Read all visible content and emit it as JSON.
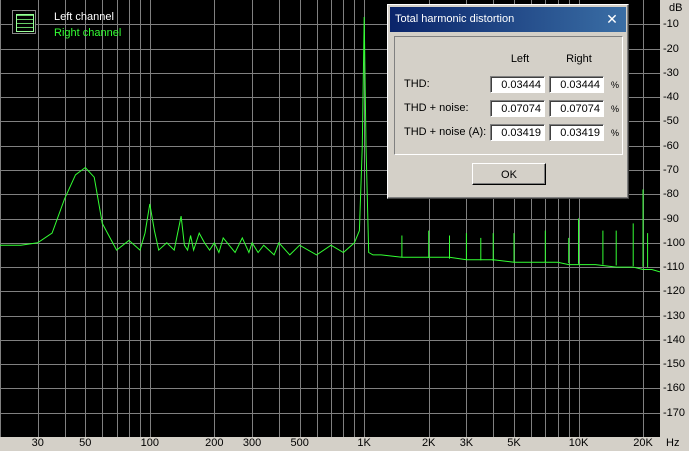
{
  "legend": {
    "left_label": "Left channel",
    "right_label": "Right channel",
    "left_color": "#ffffff",
    "right_color": "#33ff33"
  },
  "axis": {
    "y_unit": "dB",
    "x_unit": "Hz",
    "y_ticks": [
      "-10",
      "-20",
      "-30",
      "-40",
      "-50",
      "-60",
      "-70",
      "-80",
      "-90",
      "-100",
      "-110",
      "-120",
      "-130",
      "-140",
      "-150",
      "-160",
      "-170"
    ],
    "x_ticks": [
      "30",
      "50",
      "100",
      "200",
      "300",
      "500",
      "1K",
      "2K",
      "3K",
      "5K",
      "10K",
      "20K"
    ]
  },
  "dialog": {
    "title": "Total harmonic distortion",
    "close_glyph": "✕",
    "col_left": "Left",
    "col_right": "Right",
    "rows": [
      {
        "label": "THD:",
        "left": "0.03444",
        "right": "0.03444",
        "unit": "%"
      },
      {
        "label": "THD + noise:",
        "left": "0.07074",
        "right": "0.07074",
        "unit": "%"
      },
      {
        "label": "THD + noise (A):",
        "left": "0.03419",
        "right": "0.03419",
        "unit": "%"
      }
    ],
    "ok_label": "OK"
  },
  "colors": {
    "plot_background": "#000000",
    "grid": "#808080",
    "trace": "#33ff33",
    "dialog_title": "#0a246a"
  },
  "chart_data": {
    "type": "line",
    "xscale": "log",
    "xlim": [
      20,
      24000
    ],
    "ylim": [
      -180,
      0
    ],
    "ylabel": "dB",
    "xlabel": "Hz",
    "series": [
      {
        "name": "Right channel",
        "x": [
          20,
          25,
          30,
          35,
          40,
          45,
          50,
          55,
          60,
          70,
          80,
          90,
          95,
          100,
          105,
          110,
          120,
          130,
          140,
          145,
          150,
          155,
          160,
          170,
          180,
          190,
          200,
          210,
          220,
          250,
          270,
          290,
          300,
          320,
          340,
          380,
          400,
          450,
          500,
          600,
          700,
          800,
          900,
          950,
          980,
          1000,
          1020,
          1050,
          1100,
          1200,
          1500,
          2000,
          2500,
          3000,
          3500,
          4000,
          5000,
          6000,
          7000,
          8000,
          9000,
          10000,
          12000,
          15000,
          18000,
          20000,
          22000,
          24000
        ],
        "y": [
          -101,
          -101,
          -100,
          -96,
          -82,
          -72,
          -69,
          -73,
          -92,
          -103,
          -99,
          -103,
          -96,
          -84,
          -95,
          -103,
          -100,
          -103,
          -89,
          -101,
          -103,
          -97,
          -103,
          -96,
          -100,
          -103,
          -100,
          -104,
          -98,
          -104,
          -98,
          -104,
          -100,
          -104,
          -101,
          -105,
          -100,
          -105,
          -101,
          -105,
          -101,
          -104,
          -100,
          -95,
          -60,
          -7,
          -60,
          -104,
          -105,
          -105,
          -106,
          -106,
          -106,
          -107,
          -107,
          -107,
          -108,
          -108,
          -108,
          -108,
          -109,
          -109,
          -109,
          -110,
          -110,
          -111,
          -111,
          -112
        ]
      }
    ]
  }
}
